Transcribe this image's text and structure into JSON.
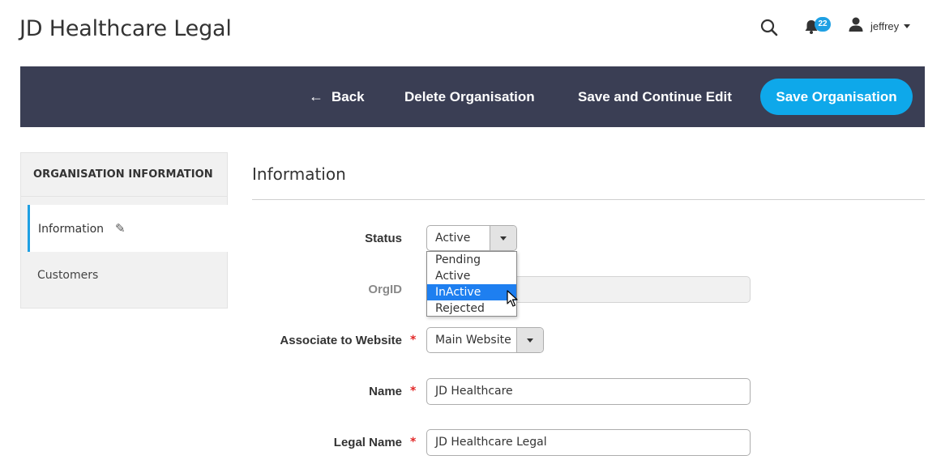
{
  "header": {
    "title": "JD Healthcare Legal",
    "notification_count": "22",
    "user_name": "jeffrey",
    "icons": {
      "search": "search-icon",
      "bell": "bell-icon",
      "user": "user-icon"
    }
  },
  "action_bar": {
    "back_label": "Back",
    "delete_label": "Delete Organisation",
    "save_continue_label": "Save and Continue Edit",
    "save_label": "Save Organisation"
  },
  "sidebar": {
    "heading": "ORGANISATION INFORMATION",
    "items": [
      {
        "label": "Information",
        "active": true
      },
      {
        "label": "Customers",
        "active": false
      }
    ]
  },
  "main": {
    "section_title": "Information",
    "fields": {
      "status": {
        "label": "Status",
        "value": "Active",
        "options": [
          "Pending",
          "Active",
          "InActive",
          "Rejected"
        ],
        "highlighted": "InActive"
      },
      "orgid": {
        "label": "OrgID",
        "value": ""
      },
      "website": {
        "label": "Associate to Website",
        "value": "Main Website",
        "required_mark": "*"
      },
      "name": {
        "label": "Name",
        "value": "JD Healthcare",
        "required_mark": "*"
      },
      "legal_name": {
        "label": "Legal Name",
        "value": "JD Healthcare Legal",
        "required_mark": "*"
      }
    }
  },
  "colors": {
    "action_bar_bg": "#3a3e54",
    "primary_button": "#0ea8ea",
    "badge": "#1fa0e3",
    "active_accent": "#1fa0e3",
    "required": "#e22626",
    "dropdown_highlight": "#1e7ff0"
  }
}
